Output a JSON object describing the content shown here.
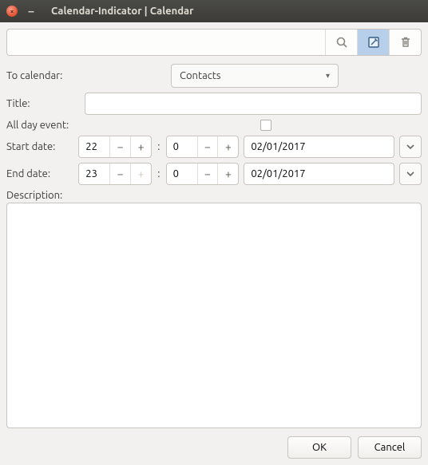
{
  "window": {
    "title": "Calendar-Indicator | Calendar"
  },
  "toolbar": {
    "search_icon": "search",
    "edit_icon": "edit",
    "trash_icon": "trash"
  },
  "form": {
    "to_calendar_label": "To calendar:",
    "to_calendar_value": "Contacts",
    "title_label": "Title:",
    "title_value": "",
    "allday_label": "All day event:",
    "allday_checked": false,
    "start_label": "Start date:",
    "start_hour": "22",
    "start_min": "0",
    "start_date": "02/01/2017",
    "end_label": "End date:",
    "end_hour": "23",
    "end_min": "0",
    "end_date": "02/01/2017",
    "description_label": "Description:",
    "description_value": ""
  },
  "buttons": {
    "ok": "OK",
    "cancel": "Cancel"
  }
}
